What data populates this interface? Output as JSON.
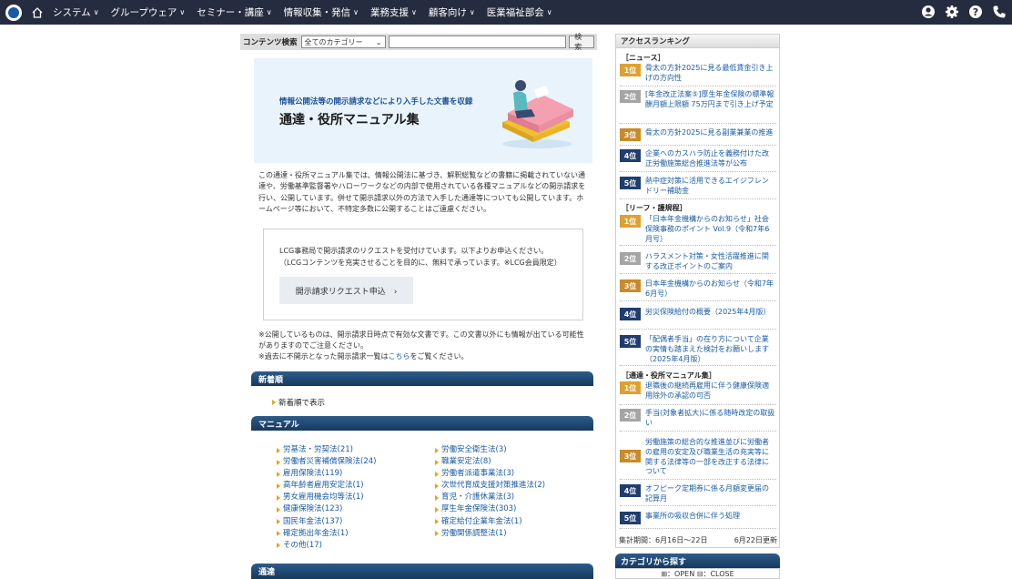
{
  "nav": {
    "items": [
      "システム",
      "グループウェア",
      "セミナー・講座",
      "情報収集・発信",
      "業務支援",
      "顧客向け",
      "医業福祉部会"
    ]
  },
  "search": {
    "label": "コンテンツ検索",
    "category": "全てのカテゴリー",
    "button": "検索"
  },
  "banner": {
    "subtitle": "情報公開法等の開示請求などにより入手した文書を収録",
    "title": "通達・役所マニュアル集"
  },
  "intro": "この通達・役所マニュアル集では、情報公開法に基づき、解釈総覧などの書籍に掲載されていない通達や、労働基準監督署やハローワークなどの内部で使用されている各種マニュアルなどの開示請求を行い、公開しています。併せて開示請求以外の方法で入手した通達等についても公開しています。ホームページ等において、不特定多数に公開することはご遠慮ください。",
  "request": {
    "line1": "LCG事務局で開示請求のリクエストを受付けています。以下よりお申込ください。",
    "line2": "（LCGコンテンツを充実させることを目的に、無料で承っています。※LCG会員限定）",
    "button": "開示請求リクエスト申込　›"
  },
  "notes": {
    "line1": "※公開しているものは、開示請求日時点で有効な文書です。この文書以外にも情報が出ている可能性がありますのでご注意ください。",
    "line2a": "※過去に不開示となった開示請求一覧は",
    "line2link": "こちら",
    "line2b": "をご覧ください。"
  },
  "sections": {
    "newest": "新着順",
    "newest_link": "新着順で表示",
    "manual": "マニュアル",
    "tsutatsu": "通達"
  },
  "manual_left": [
    "労基法・労契法(21)",
    "労働者災害補償保険法(24)",
    "雇用保険法(119)",
    "高年齢者雇用安定法(1)",
    "男女雇用機会均等法(1)",
    "健康保険法(123)",
    "国民年金法(137)",
    "確定拠出年金法(1)",
    "その他(17)"
  ],
  "manual_right": [
    "労働安全衛生法(3)",
    "職業安定法(8)",
    "労働者派遣事業法(3)",
    "次世代育成支援対策推進法(2)",
    "育児・介護休業法(3)",
    "厚生年金保険法(303)",
    "確定給付企業年金法(1)",
    "労働関係調整法(1)"
  ],
  "ranking": {
    "title": "アクセスランキング",
    "cat_news": "［ニュース］",
    "cat_leaf": "［リーフ・護規程］",
    "cat_manual": "［通達・役所マニュアル集］",
    "news": [
      {
        "rank": "1位",
        "text": "骨太の方針2025に見る最低賃金引き上げの方向性"
      },
      {
        "rank": "2位",
        "text": "[年金改正法案⑤]厚生年金保険の標準報酬月額上限額 75万円まで引き上げ予定"
      },
      {
        "rank": "3位",
        "text": "骨太の方針2025に見る副業兼業の推進"
      },
      {
        "rank": "4位",
        "text": "企業へのカスハラ防止を義務付けた改正労働施策総合推進法等が公布"
      },
      {
        "rank": "5位",
        "text": "熱中症対策に活用できるエイジフレンドリー補助金"
      }
    ],
    "leaf": [
      {
        "rank": "1位",
        "text": "「日本年金機構からのお知らせ」社会保険事務のポイント Vol.9（令和7年6月号）"
      },
      {
        "rank": "2位",
        "text": "ハラスメント対策・女性活躍推進に関する改正ポイントのご案内"
      },
      {
        "rank": "3位",
        "text": "日本年金機構からのお知らせ（令和7年6月号）"
      },
      {
        "rank": "4位",
        "text": "労災保険給付の概要（2025年4月版）"
      },
      {
        "rank": "5位",
        "text": "「配偶者手当」の在り方について企業の実情も踏まえた検討をお願いします（2025年4月版）"
      }
    ],
    "manual": [
      {
        "rank": "1位",
        "text": "退職後の継続再雇用に伴う健康保険適用除外の承認の可否"
      },
      {
        "rank": "2位",
        "text": "手当(対象者拡大)に係る随時改定の取扱い"
      },
      {
        "rank": "3位",
        "text": "労働施策の総合的な推進並びに労働者の雇用の安定及び職業生活の充実等に関する法律等の一部を改正する法律について"
      },
      {
        "rank": "4位",
        "text": "オフピーク定期券に係る月額変更届の記算月"
      },
      {
        "rank": "5位",
        "text": "事業所の吸収合併に伴う処理"
      }
    ],
    "period": "集計期間：6月16日～22日",
    "updated": "6月22日更新"
  },
  "category": {
    "title": "カテゴリから探す",
    "open_close": "⊞：OPEN ⊟：CLOSE"
  },
  "colors": {
    "topbar": "#252c3f",
    "link": "#1a5ba6",
    "section": "#1e4a77"
  }
}
